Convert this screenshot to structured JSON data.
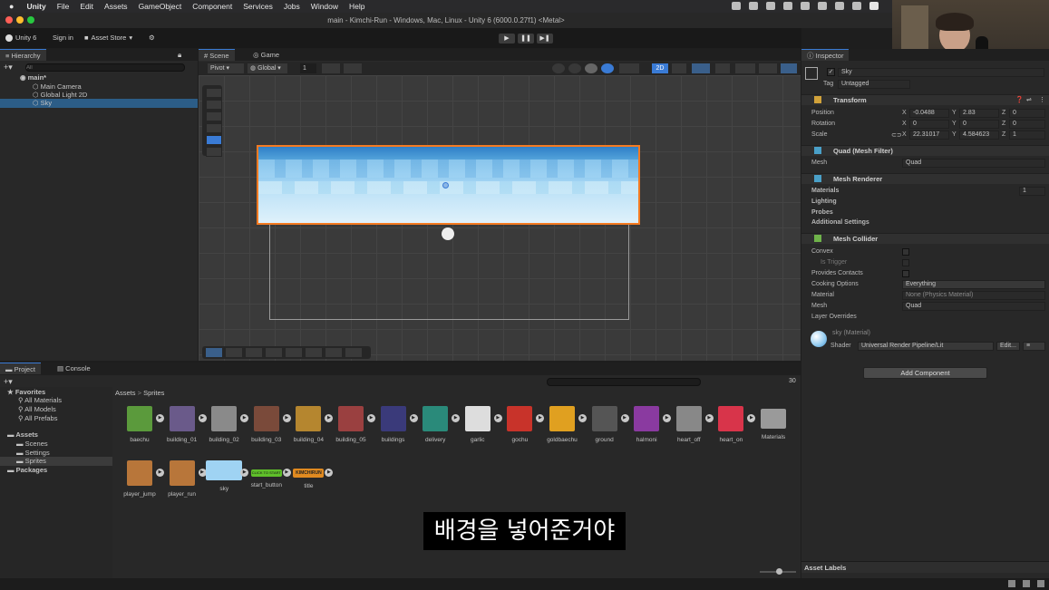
{
  "menubar": {
    "apple": "",
    "items": [
      "Unity",
      "File",
      "Edit",
      "Assets",
      "GameObject",
      "Component",
      "Services",
      "Jobs",
      "Window",
      "Help"
    ]
  },
  "window": {
    "title": "main - Kimchi-Run - Windows, Mac, Linux - Unity 6 (6000.0.27f1) <Metal>"
  },
  "toolbar": {
    "account": "Unity 6",
    "sign_in": "Sign in",
    "asset_store": "Asset Store",
    "play": "▶",
    "pause": "❚❚",
    "step": "▶❚"
  },
  "hierarchy": {
    "tab": "Hierarchy",
    "search_placeholder": "All",
    "scene": "main*",
    "items": [
      "Main Camera",
      "Global Light 2D",
      "Sky"
    ]
  },
  "scene_view": {
    "tabs": [
      "Scene",
      "Game"
    ],
    "pivot": "Pivot",
    "global": "Global",
    "grid_value": "1",
    "mode_2d": "2D"
  },
  "inspector": {
    "tab": "Inspector",
    "object_name": "Sky",
    "tag_label": "Tag",
    "tag_value": "Untagged",
    "transform": {
      "title": "Transform",
      "position_label": "Position",
      "rotation_label": "Rotation",
      "scale_label": "Scale",
      "position": {
        "x": "-0.0488",
        "y": "2.83",
        "z": "0"
      },
      "rotation": {
        "x": "0",
        "y": "0",
        "z": "0"
      },
      "scale": {
        "x": "22.31017",
        "y": "4.584623",
        "z": "1"
      }
    },
    "mesh_filter": {
      "title": "Quad (Mesh Filter)",
      "mesh_label": "Mesh",
      "mesh_value": "Quad"
    },
    "mesh_renderer": {
      "title": "Mesh Renderer",
      "materials": "Materials",
      "materials_count": "1",
      "lighting": "Lighting",
      "probes": "Probes",
      "additional": "Additional Settings"
    },
    "mesh_collider": {
      "title": "Mesh Collider",
      "convex": "Convex",
      "is_trigger": "Is Trigger",
      "provides_contacts": "Provides Contacts",
      "cooking_options": "Cooking Options",
      "cooking_value": "Everything",
      "material": "Material",
      "material_value": "None (Physics Material)",
      "mesh": "Mesh",
      "mesh_value": "Quad",
      "layer_overrides": "Layer Overrides"
    },
    "material": {
      "name": "sky (Material)",
      "shader_label": "Shader",
      "shader_value": "Universal Render Pipeline/Lit",
      "edit": "Edit...",
      "list_icon": "≡"
    },
    "add_component": "Add Component",
    "asset_labels": "Asset Labels"
  },
  "project": {
    "tabs": [
      "Project",
      "Console"
    ],
    "favorites": "Favorites",
    "fav_items": [
      "All Materials",
      "All Models",
      "All Prefabs"
    ],
    "assets": "Assets",
    "asset_folders": [
      "Scenes",
      "Settings",
      "Sprites"
    ],
    "packages": "Packages",
    "breadcrumb_root": "Assets",
    "breadcrumb_sep": ">",
    "breadcrumb_current": "Sprites",
    "count": "30",
    "items_row1": [
      "baechu",
      "building_01",
      "building_02",
      "building_03",
      "building_04",
      "building_05",
      "buildings",
      "delivery",
      "garlic",
      "gochu",
      "goldbaechu",
      "ground",
      "halmoni",
      "heart_off",
      "heart_on",
      "Materials"
    ],
    "items_row2": [
      "player_jump",
      "player_run",
      "sky",
      "start_button",
      "title"
    ],
    "start_button_text": "CLICK TO START",
    "title_text": "KIMCHIRUN"
  },
  "subtitle": "배경을 넣어준거야",
  "colors": {
    "accent": "#3a7bd5",
    "selection_orange": "#f47a21",
    "sky_light": "#bfe3f7",
    "sky_dark": "#4f9fd8"
  }
}
